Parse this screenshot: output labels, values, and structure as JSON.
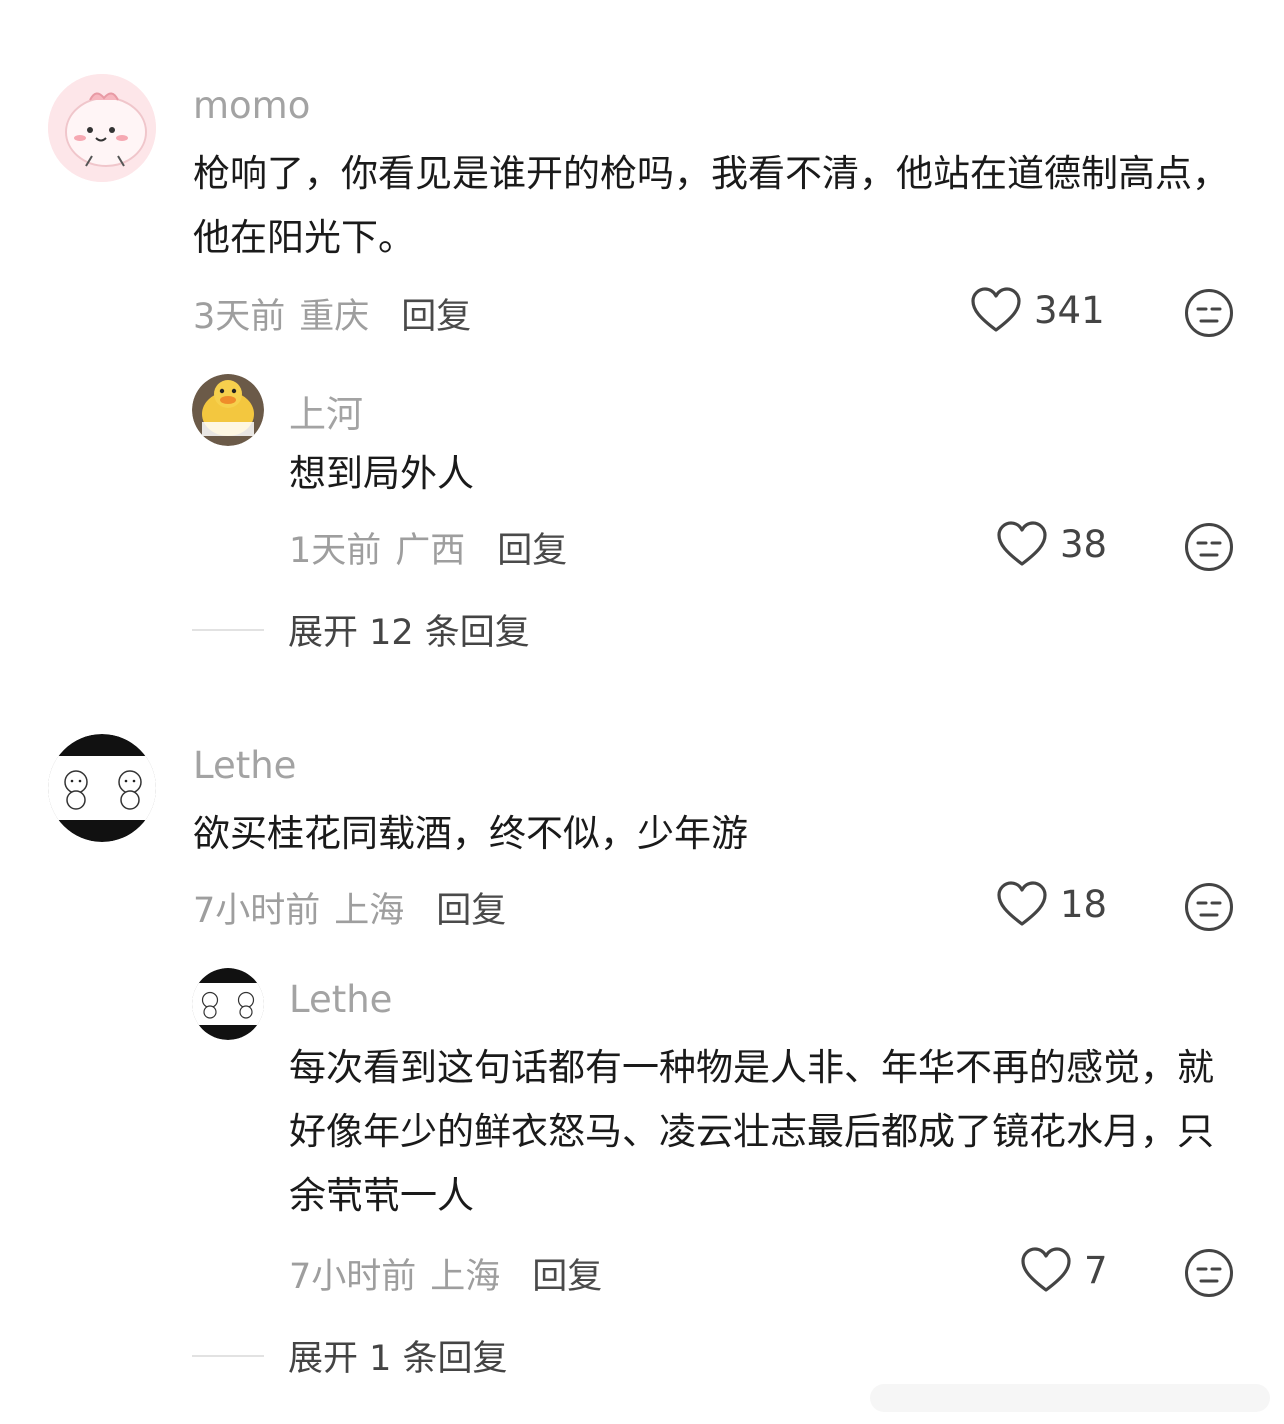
{
  "comments": [
    {
      "user": "momo",
      "text": "枪响了，你看见是谁开的枪吗，我看不清，他站在道德制高点，他在阳光下。",
      "time": "3天前",
      "location": "重庆",
      "reply_label": "回复",
      "likes": "341",
      "replies": [
        {
          "user": "上河",
          "text": "想到局外人",
          "time": "1天前",
          "location": "广西",
          "reply_label": "回复",
          "likes": "38"
        }
      ],
      "expand_label": "展开 12 条回复"
    },
    {
      "user": "Lethe",
      "text": "欲买桂花同载酒，终不似，少年游",
      "time": "7小时前",
      "location": "上海",
      "reply_label": "回复",
      "likes": "18",
      "replies": [
        {
          "user": "Lethe",
          "text": "每次看到这句话都有一种物是人非、年华不再的感觉，就好像年少的鲜衣怒马、凌云壮志最后都成了镜花水月，只余茕茕一人",
          "time": "7小时前",
          "location": "上海",
          "reply_label": "回复",
          "likes": "7"
        }
      ],
      "expand_label": "展开 1 条回复"
    }
  ],
  "icons": {
    "like": "heart-outline-icon",
    "dislike": "neutral-face-icon"
  },
  "colors": {
    "name": "#a3a3a3",
    "meta": "#9e9e9e",
    "text": "#1a1a1a",
    "avatar_momo": "#fde3e6"
  }
}
